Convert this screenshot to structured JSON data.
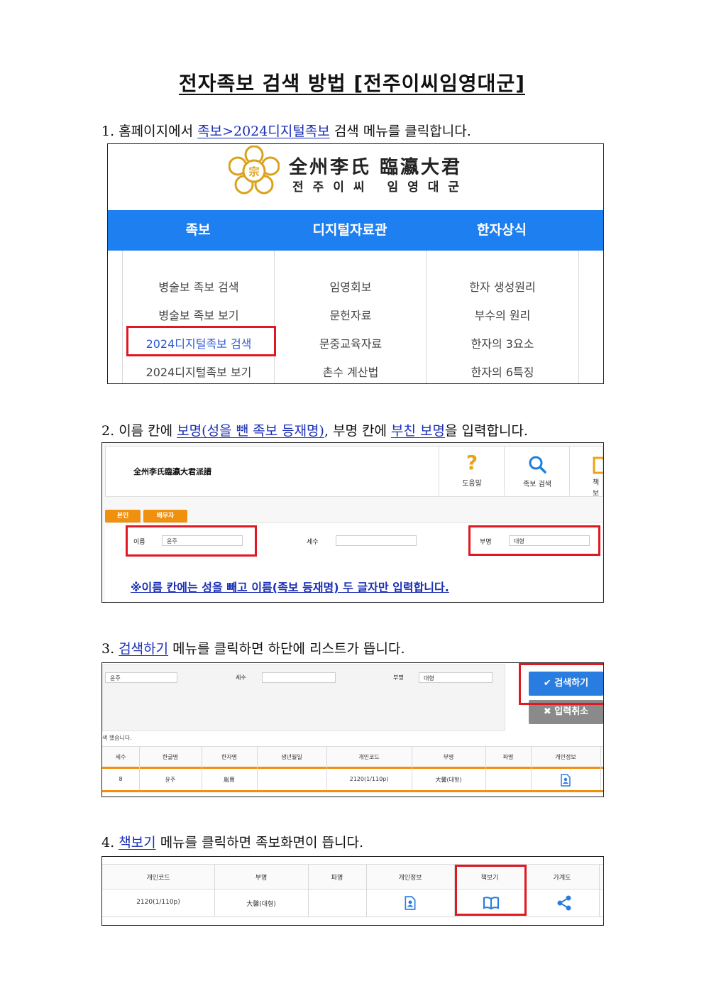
{
  "doc": {
    "title": "전자족보 검색 방법 [전주이씨임영대군]"
  },
  "steps": [
    {
      "num": "1.",
      "pre": "홈페이지에서",
      "link": "족보>2024디지털족보",
      "post": "검색 메뉴를 클릭합니다."
    },
    {
      "num": "2.",
      "pre": "이름 칸에",
      "link": "보명(성을 뺀 족보 등재명)",
      "mid": ", 부명 칸에",
      "link2": "부친 보명",
      "post": "을 입력합니다."
    },
    {
      "num": "3.",
      "pre": "",
      "link": "검색하기",
      "post": "메뉴를 클릭하면 하단에 리스트가 뜹니다."
    },
    {
      "num": "4.",
      "pre": "",
      "link": "책보기",
      "post": "메뉴를 클릭하면 족보화면이 뜹니다."
    }
  ],
  "shot1": {
    "logo_hanja": "全州李氏 臨瀛大君",
    "logo_hangul": "전주이씨 임영대군",
    "nav": [
      "족보",
      "디지털자료관",
      "한자상식"
    ],
    "col1": [
      "병술보 족보 검색",
      "병술보 족보 보기",
      "2024디지털족보 검색",
      "2024디지털족보 보기"
    ],
    "col2": [
      "임영회보",
      "문헌자료",
      "문중교육자료",
      "촌수 계산법"
    ],
    "col3": [
      "한자 생성원리",
      "부수의 원리",
      "한자의 3요소",
      "한자의 6특징"
    ]
  },
  "shot2": {
    "site_title": "全州李氏臨瀛大君派譜",
    "tools": [
      {
        "icon": "question-icon",
        "glyph": "?",
        "label": "도움말"
      },
      {
        "icon": "search-icon",
        "glyph": "",
        "label": "족보 검색"
      },
      {
        "icon": "book-icon",
        "glyph": "",
        "label": "책보"
      }
    ],
    "tabs": [
      "본인",
      "배우자"
    ],
    "name_label": "이름",
    "name_value": "윤주",
    "gen_label": "세수",
    "gen_value": "",
    "father_label": "부명",
    "father_value": "대형",
    "note": "※이름 칸에는 성을 빼고 이름(족보 등재명) 두 글자만 입력합니다."
  },
  "shot3": {
    "name_value": "윤주",
    "gen_label": "세수",
    "father_label": "부명",
    "father_value": "대형",
    "search_btn": "검색하기",
    "reset_btn": "입력취소",
    "result_msg": "색 했습니다.",
    "headers": [
      "세수",
      "한글명",
      "한자명",
      "생년월일",
      "개인코드",
      "부명",
      "파명",
      "개인정보"
    ],
    "row": [
      "8",
      "윤주",
      "胤冑",
      "",
      "2120(1/110p)",
      "大馨(대형)",
      "",
      ""
    ]
  },
  "shot4": {
    "headers": [
      "개인코드",
      "부명",
      "파명",
      "개인정보",
      "책보기",
      "가계도"
    ],
    "row": [
      "2120(1/110p)",
      "大馨(대형)",
      "",
      "",
      "",
      ""
    ]
  },
  "colors": {
    "nav_blue": "#1e7ff0",
    "highlight_red": "#e01822",
    "tab_orange": "#f0900f",
    "link_blue": "#1a2fb5",
    "btn_blue": "#2a7de0",
    "btn_gray": "#8a8a8a"
  }
}
